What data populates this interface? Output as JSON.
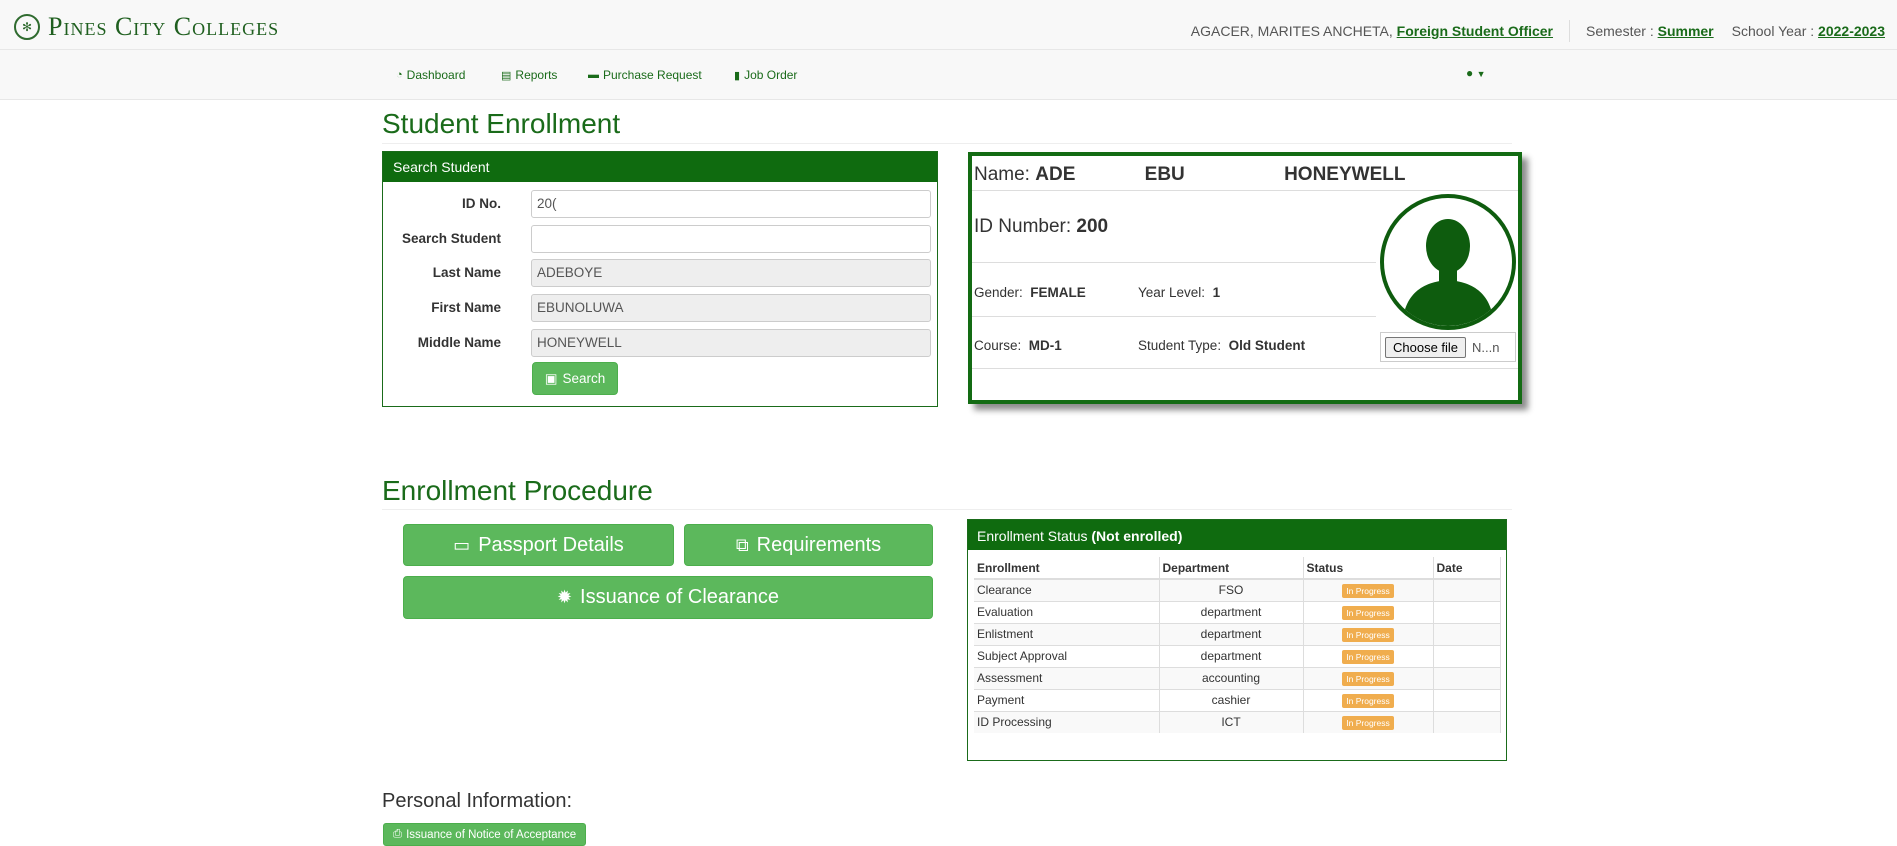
{
  "header": {
    "brand": "Pines City Colleges",
    "user_name": "AGACER, MARITES ANCHETA,",
    "user_role": "Foreign Student Officer",
    "semester_label": "Semester :",
    "semester_value": "Summer",
    "school_year_label": "School Year :",
    "school_year_value": "2022-2023"
  },
  "nav": {
    "items": [
      {
        "label": "Dashboard",
        "icon": "dashboard-icon"
      },
      {
        "label": "Reports",
        "icon": "file-icon"
      },
      {
        "label": "Purchase Request",
        "icon": "money-icon"
      },
      {
        "label": "Job Order",
        "icon": "file-icon"
      }
    ],
    "user_menu_icon": "user-icon"
  },
  "enrollment": {
    "title": "Student Enrollment",
    "search_panel": {
      "title": "Search Student",
      "id_label": "ID No.",
      "id_value": "20(",
      "search_label": "Search Student",
      "search_value": "",
      "last_label": "Last Name",
      "last_value": "ADEBOYE",
      "first_label": "First Name",
      "first_value": "EBUNOLUWA",
      "middle_label": "Middle Name",
      "middle_value": "HONEYWELL",
      "search_button": "Search"
    }
  },
  "profile": {
    "name_label": "Name:",
    "name_first": "ADE",
    "name_middle": "EBU",
    "name_last": "HONEYWELL",
    "id_label": "ID Number:",
    "id_value": "200",
    "gender_label": "Gender:",
    "gender_value": "FEMALE",
    "year_label": "Year Level:",
    "year_value": "1",
    "course_label": "Course:",
    "course_value": "MD-1",
    "type_label": "Student Type:",
    "type_value": "Old Student",
    "file_button": "Choose file",
    "file_name": "N...n"
  },
  "procedure": {
    "title": "Enrollment Procedure",
    "passport_button": "Passport Details",
    "requirements_button": "Requirements",
    "clearance_button": "Issuance of Clearance"
  },
  "status": {
    "title": "Enrollment Status",
    "state": "(Not enrolled)",
    "columns": [
      "Enrollment",
      "Department",
      "Status",
      "Date"
    ],
    "rows": [
      {
        "enrollment": "Clearance",
        "department": "FSO",
        "status": "In Progress",
        "date": ""
      },
      {
        "enrollment": "Evaluation",
        "department": "department",
        "status": "In Progress",
        "date": ""
      },
      {
        "enrollment": "Enlistment",
        "department": "department",
        "status": "In Progress",
        "date": ""
      },
      {
        "enrollment": "Subject Approval",
        "department": "department",
        "status": "In Progress",
        "date": ""
      },
      {
        "enrollment": "Assessment",
        "department": "accounting",
        "status": "In Progress",
        "date": ""
      },
      {
        "enrollment": "Payment",
        "department": "cashier",
        "status": "In Progress",
        "date": ""
      },
      {
        "enrollment": "ID Processing",
        "department": "ICT",
        "status": "In Progress",
        "date": ""
      }
    ]
  },
  "personal": {
    "title": "Personal Information:",
    "notice_button": "Issuance of Notice of Acceptance"
  },
  "colors": {
    "brand_green": "#0f6b0f",
    "button_green": "#5cb85c",
    "badge_orange": "#f0ad4e"
  }
}
